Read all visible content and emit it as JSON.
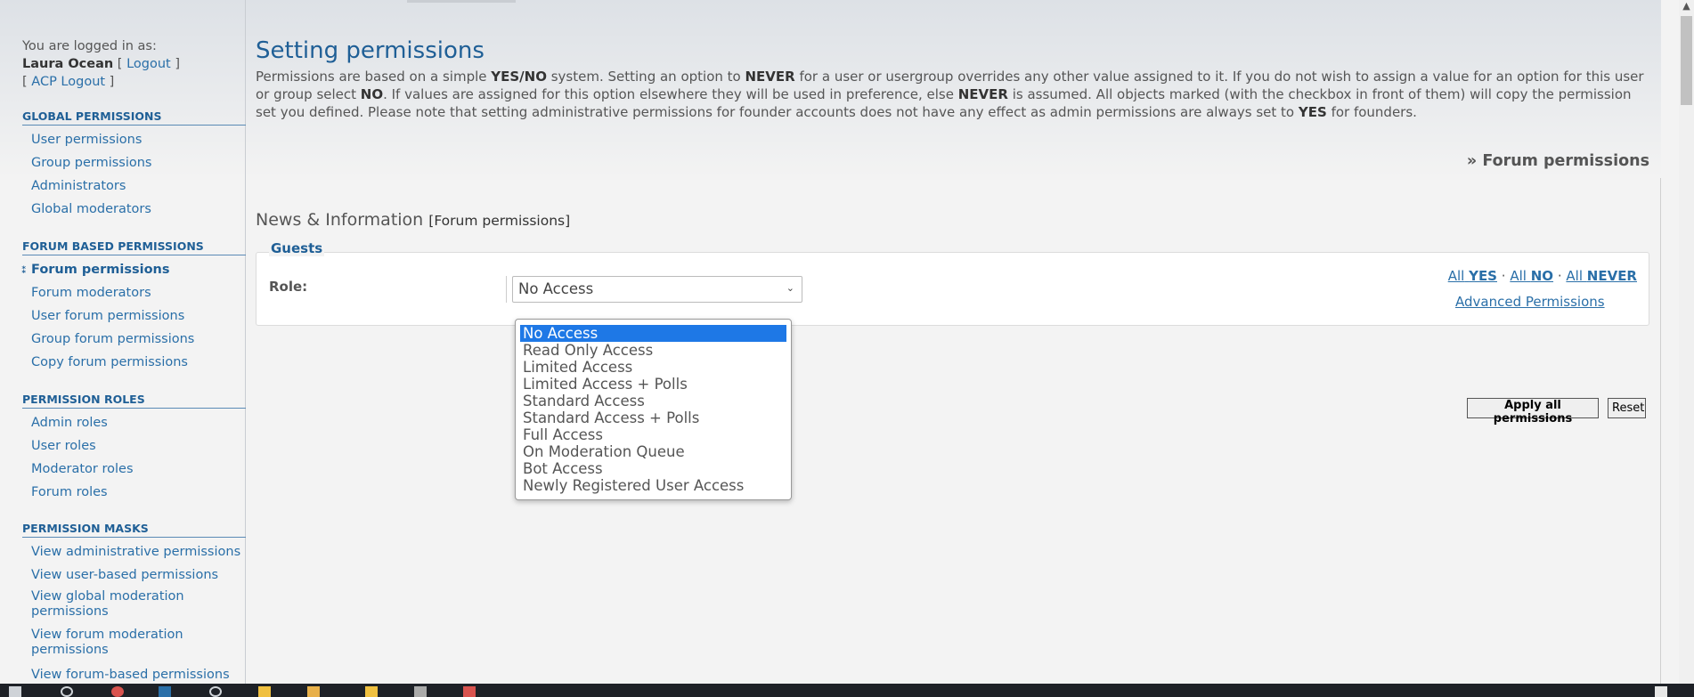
{
  "login": {
    "prefix": "You are logged in as:",
    "username": "Laura Ocean",
    "logout": "Logout",
    "acp_logout": "ACP Logout"
  },
  "sidebar": {
    "global": {
      "title": "GLOBAL PERMISSIONS",
      "items": [
        "User permissions",
        "Group permissions",
        "Administrators",
        "Global moderators"
      ]
    },
    "forum": {
      "title": "FORUM BASED PERMISSIONS",
      "items": [
        "Forum permissions",
        "Forum moderators",
        "User forum permissions",
        "Group forum permissions",
        "Copy forum permissions"
      ]
    },
    "roles": {
      "title": "PERMISSION ROLES",
      "items": [
        "Admin roles",
        "User roles",
        "Moderator roles",
        "Forum roles"
      ]
    },
    "masks": {
      "title": "PERMISSION MASKS",
      "items": [
        "View administrative permissions",
        "View user-based permissions",
        "View global moderation permissions",
        "View forum moderation permissions",
        "View forum-based permissions"
      ]
    }
  },
  "main": {
    "title": "Setting permissions",
    "intro": {
      "p1": "Permissions are based on a simple ",
      "yesno": "YES/NO",
      "p2": " system. Setting an option to ",
      "never": "NEVER",
      "p3": " for a user or usergroup overrides any other value assigned to it. If you do not wish to assign a value for an option for this user or group select ",
      "no": "NO",
      "p4": ". If values are assigned for this option elsewhere they will be used in preference, else ",
      "never2": "NEVER",
      "p5": " is assumed. All objects marked (with the checkbox in front of them) will copy the permission set you defined. Please note that setting administrative permissions for founder accounts does not have any effect as admin permissions are always set to ",
      "yes": "YES",
      "p6": " for founders."
    },
    "breadcrumb": "» Forum permissions",
    "forum_name": "News & Information",
    "forum_sub": "[Forum permissions]",
    "group_legend": "Guests",
    "role_label": "Role:",
    "role_value": "No Access",
    "all_links": {
      "all": "All",
      "yes": "YES",
      "no": "NO",
      "never": "NEVER",
      "sep": "·"
    },
    "advanced": "Advanced Permissions",
    "apply_button": "Apply all permissions",
    "reset_button": "Reset"
  },
  "dropdown": {
    "options": [
      "No Access",
      "Read Only Access",
      "Limited Access",
      "Limited Access + Polls",
      "Standard Access",
      "Standard Access + Polls",
      "Full Access",
      "On Moderation Queue",
      "Bot Access",
      "Newly Registered User Access"
    ],
    "selected_index": 0
  },
  "colors": {
    "link": "#2a6fa8",
    "heading": "#1f5f96",
    "selection": "#1e78e6"
  }
}
